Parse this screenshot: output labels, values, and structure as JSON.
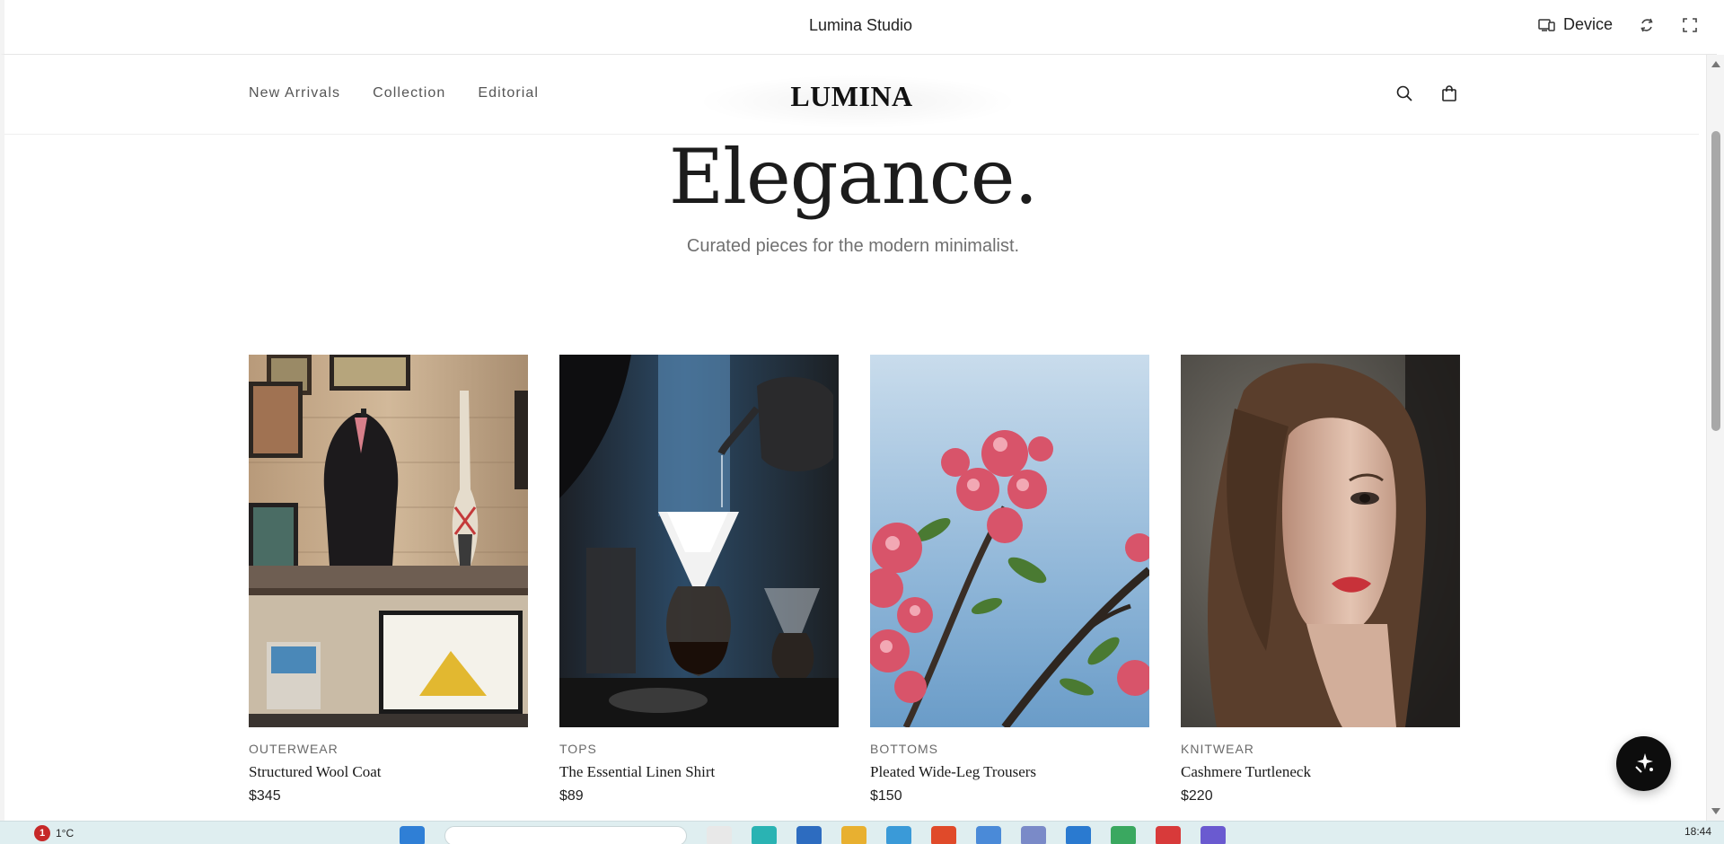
{
  "topbar": {
    "title": "Lumina Studio",
    "device_label": "Device"
  },
  "site": {
    "logo": "LUMINA",
    "nav": [
      "New Arrivals",
      "Collection",
      "Editorial"
    ]
  },
  "hero": {
    "title": "Elegance.",
    "subtitle": "Curated pieces for the modern minimalist."
  },
  "products": [
    {
      "category": "OUTERWEAR",
      "name": "Structured Wool Coat",
      "price": "$345"
    },
    {
      "category": "TOPS",
      "name": "The Essential Linen Shirt",
      "price": "$89"
    },
    {
      "category": "BOTTOMS",
      "name": "Pleated Wide-Leg Trousers",
      "price": "$150"
    },
    {
      "category": "KNITWEAR",
      "name": "Cashmere Turtleneck",
      "price": "$220"
    }
  ],
  "taskbar": {
    "notification_count": "1",
    "temperature": "1°C",
    "time": "18:44"
  },
  "icons": {
    "device": "device-icon",
    "rotate": "rotate-icon",
    "fullscreen": "fullscreen-icon",
    "search": "search-icon",
    "bag": "shopping-bag-icon",
    "fab": "sparkle-icon"
  },
  "colors": {
    "accent": "#0d0d0d",
    "background": "#ffffff",
    "muted_text": "#707070"
  }
}
